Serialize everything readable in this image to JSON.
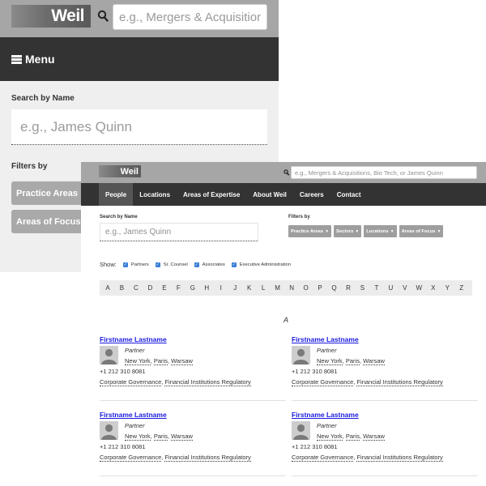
{
  "brand": {
    "logo": "Weil"
  },
  "mobile": {
    "search_placeholder": "e.g., Mergers & Acquisitions",
    "menu_label": "Menu",
    "search_by_name_label": "Search by Name",
    "name_placeholder": "e.g., James Quinn",
    "filters_label": "Filters by",
    "filters": [
      "Practice Areas",
      "Areas of Focus"
    ]
  },
  "desktop": {
    "search_placeholder": "e.g., Mergers & Acquisitions, Bio Tech, or James Quinn",
    "nav": [
      "People",
      "Locations",
      "Areas of Expertise",
      "About Weil",
      "Careers",
      "Contact"
    ],
    "active_nav": "People",
    "search_by_name_label": "Search by Name",
    "name_placeholder": "e.g., James Quinn",
    "filters_label": "Filters by",
    "filters": [
      "Practice Areas",
      "Sectors",
      "Locations",
      "Areas of Focus"
    ],
    "show_label": "Show:",
    "show_options": [
      {
        "label": "Partners",
        "checked": true
      },
      {
        "label": "Sr. Counsel",
        "checked": true
      },
      {
        "label": "Associates",
        "checked": true
      },
      {
        "label": "Executive Administration",
        "checked": true
      }
    ],
    "alphabet": [
      "A",
      "B",
      "C",
      "D",
      "E",
      "F",
      "G",
      "H",
      "I",
      "J",
      "K",
      "L",
      "M",
      "N",
      "O",
      "P",
      "Q",
      "R",
      "S",
      "T",
      "U",
      "V",
      "W",
      "X",
      "Y",
      "Z"
    ],
    "section_letter": "A",
    "people": [
      {
        "name": "Firstname Lastname",
        "title": "Partner",
        "offices": [
          "New York",
          "Paris",
          "Warsaw"
        ],
        "phone": "+1 212 310 8081",
        "areas": [
          "Corporate Governance",
          "Financial Institutions Regulatory"
        ]
      },
      {
        "name": "Firstname Lastname",
        "title": "Partner",
        "offices": [
          "New York",
          "Paris",
          "Warsaw"
        ],
        "phone": "+1 212 310 8081",
        "areas": [
          "Corporate Governance",
          "Financial Institutions Regulatory"
        ]
      },
      {
        "name": "Firstname Lastname",
        "title": "Partner",
        "offices": [
          "New York",
          "Paris",
          "Warsaw"
        ],
        "phone": "+1 212 310 8081",
        "areas": [
          "Corporate Governance",
          "Financial Institutions Regulatory"
        ]
      },
      {
        "name": "Firstname Lastname",
        "title": "Partner",
        "offices": [
          "New York",
          "Paris",
          "Warsaw"
        ],
        "phone": "+1 212 310 8081",
        "areas": [
          "Corporate Governance",
          "Financial Institutions Regulatory"
        ]
      }
    ]
  },
  "colors": {
    "header_gray": "#a6a6a6",
    "nav_dark": "#333333",
    "filter_gray": "#a9a9a9",
    "link_blue": "#1a1ae0",
    "checkbox_blue": "#3a7fd6"
  }
}
